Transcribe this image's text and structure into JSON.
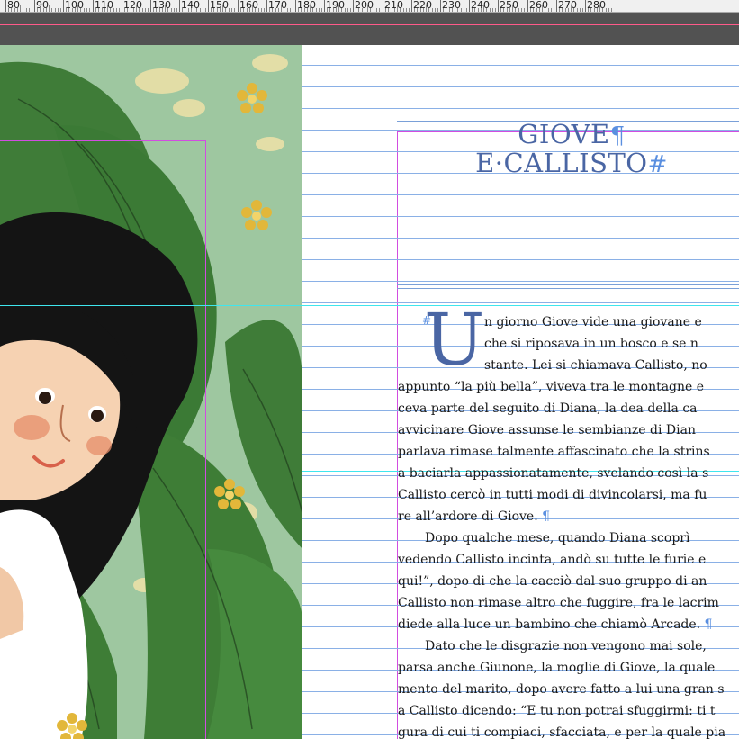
{
  "ruler": {
    "labels": [
      "80",
      "90",
      "100",
      "110",
      "120",
      "130",
      "140",
      "150",
      "160",
      "170",
      "180",
      "190",
      "200",
      "210",
      "220",
      "230",
      "240",
      "250",
      "260",
      "270",
      "280"
    ]
  },
  "colors": {
    "title": "#4a66a4",
    "pilcrow": "#5a8fe0",
    "baseline": "#8ab0e6",
    "margin": "#d14de0",
    "guide": "#3fe6ee",
    "illustration_bg": "#9ec7a0"
  },
  "illustration": {
    "icon": "illustration-girl-with-leaves"
  },
  "title": {
    "line1": "GIOVE",
    "line2": "E·CALLISTO",
    "pilcrow": "¶",
    "end_mark": "#"
  },
  "dropcap": {
    "letter": "U",
    "mark": "#"
  },
  "body": {
    "lines": [
      "n giorno Giove vide una giovane e",
      "che si riposava in un bosco e se n",
      "stante. Lei si chiamava Callisto, no",
      "appunto “la più bella”, viveva tra le montagne e",
      "ceva parte del seguito di Diana, la dea della ca",
      "avvicinare Giove assunse le sembianze di Dian",
      "parlava rimase talmente affascinato che la strins",
      "a baciarla appassionatamente, svelando così la s",
      "Callisto cercò in tutti modi di divincolarsi, ma fu",
      "re all’ardore di Giove.",
      "Dopo qualche mese, quando Diana scoprì",
      "vedendo Callisto incinta, andò su tutte le furie e",
      "qui!”, dopo di che la cacciò dal suo gruppo di an",
      "Callisto non rimase altro che fuggire, fra le lacrim",
      "diede alla luce un bambino che chiamò Arcade.",
      "Dato che le disgrazie non vengono mai sole,",
      "parsa anche Giunone, la moglie di Giove, la quale",
      "mento del marito, dopo avere fatto a lui una gran s",
      "a Callisto dicendo: “E tu non potrai sfuggirmi: ti t",
      "gura di cui ti compiaci, sfacciata, e per la quale pia"
    ],
    "pilcrow": "¶"
  }
}
